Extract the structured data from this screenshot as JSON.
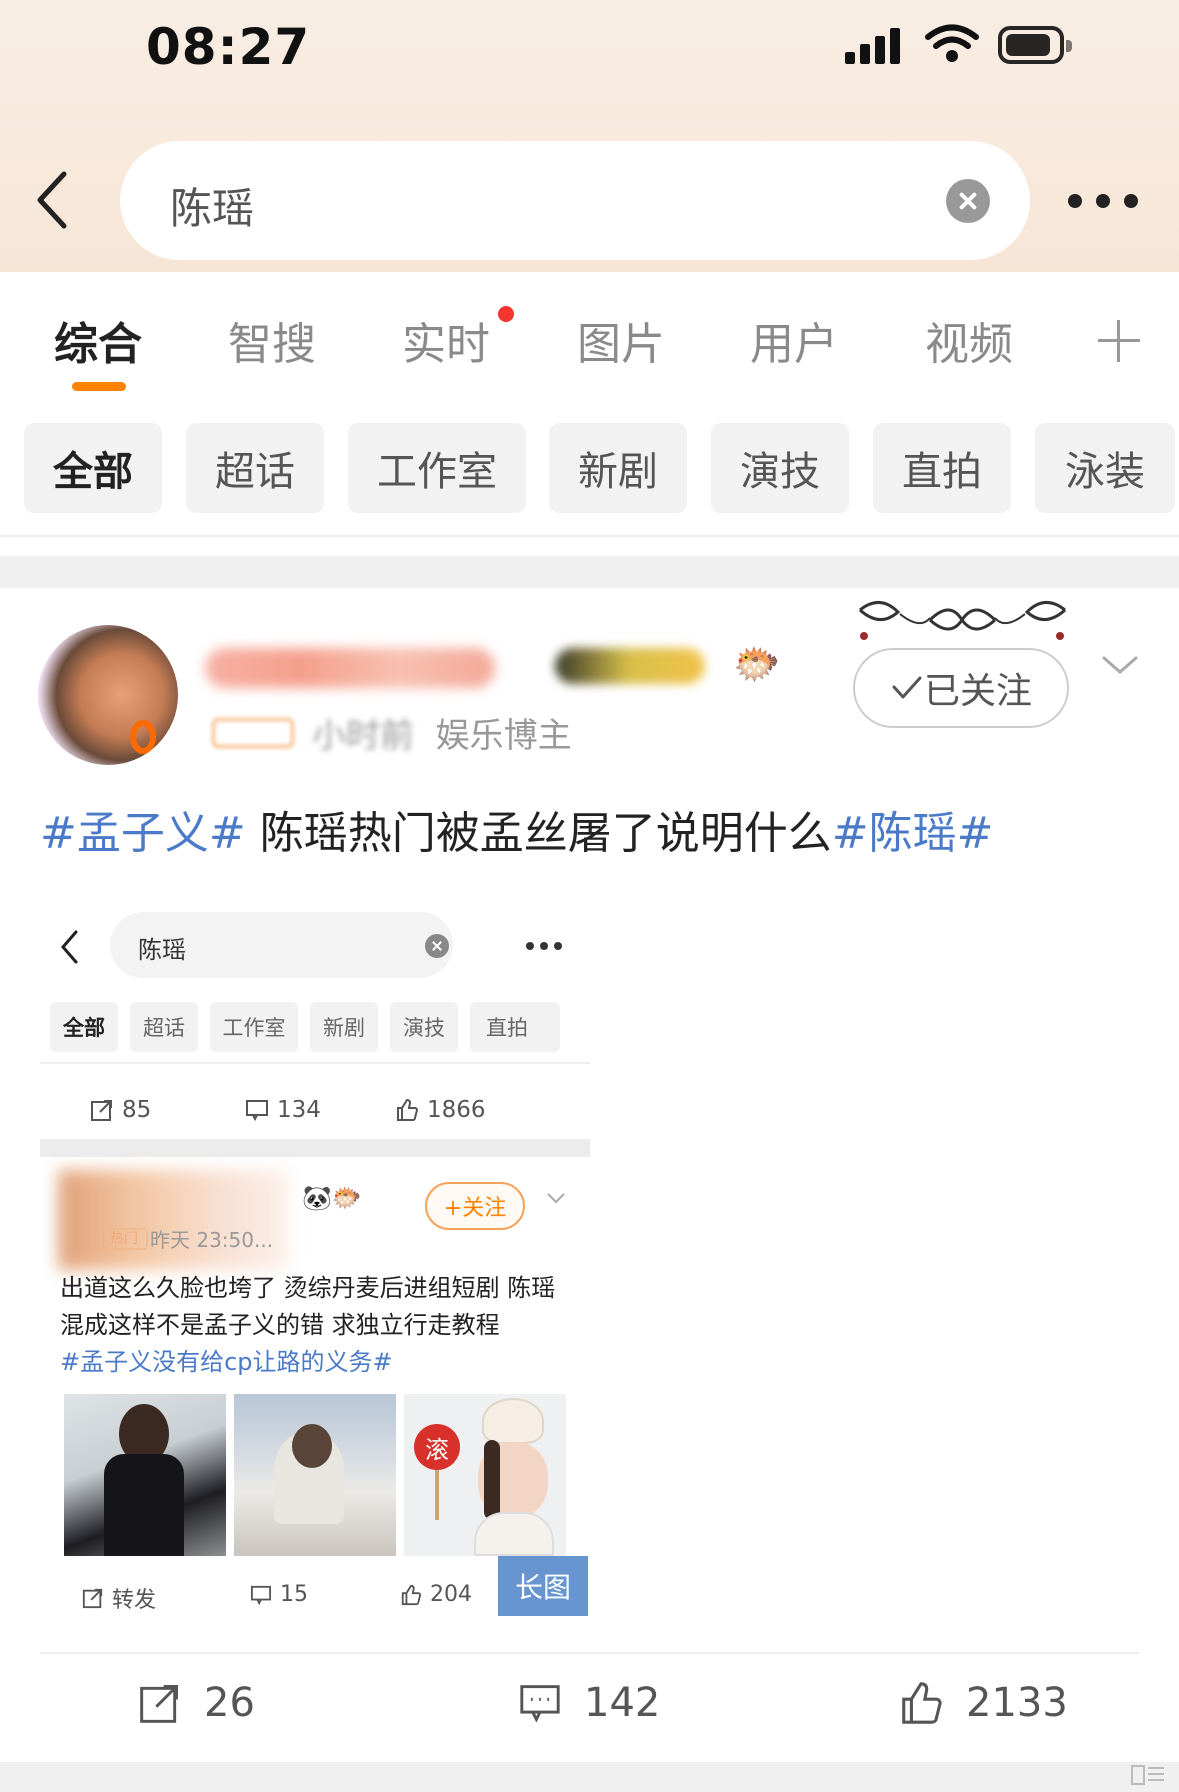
{
  "status_bar": {
    "time": "08:27"
  },
  "search": {
    "query": "陈瑶"
  },
  "tabs": [
    {
      "label": "综合",
      "active": true
    },
    {
      "label": "智搜"
    },
    {
      "label": "实时",
      "has_dot": true
    },
    {
      "label": "图片"
    },
    {
      "label": "用户"
    },
    {
      "label": "视频"
    }
  ],
  "filters": [
    "全部",
    "超话",
    "工作室",
    "新剧",
    "演技",
    "直拍",
    "泳装"
  ],
  "post": {
    "meta_time": "小时前",
    "meta_role": "娱乐博主",
    "follow_label": "已关注",
    "text_tag1": "#孟子义#",
    "text_body": " 陈瑶热门被孟丝屠了说明什么",
    "text_tag2": "#陈瑶#",
    "embedded": {
      "search_query": "陈瑶",
      "filters": [
        "全部",
        "超话",
        "工作室",
        "新剧",
        "演技",
        "直拍"
      ],
      "stats_top": {
        "repost": "85",
        "comment": "134",
        "like": "1866"
      },
      "follow_label": "+关注",
      "meta": "昨天 23:50...",
      "hot_label": "热门",
      "body": "出道这么久脸也垮了 烫综丹麦后进组短剧 陈瑶混成这样不是孟子义的错 求独立行走教程",
      "tag": "#孟子义没有给cp让路的义务#",
      "image3_badge": "滚",
      "long_image_label": "长图",
      "stats_bottom": {
        "repost": "转发",
        "comment": "15",
        "like": "204"
      }
    },
    "stats": {
      "repost": "26",
      "comment": "142",
      "like": "2133"
    }
  },
  "colors": {
    "accent": "#ff8200",
    "link": "#4a7ac8",
    "notify": "#f43530"
  }
}
